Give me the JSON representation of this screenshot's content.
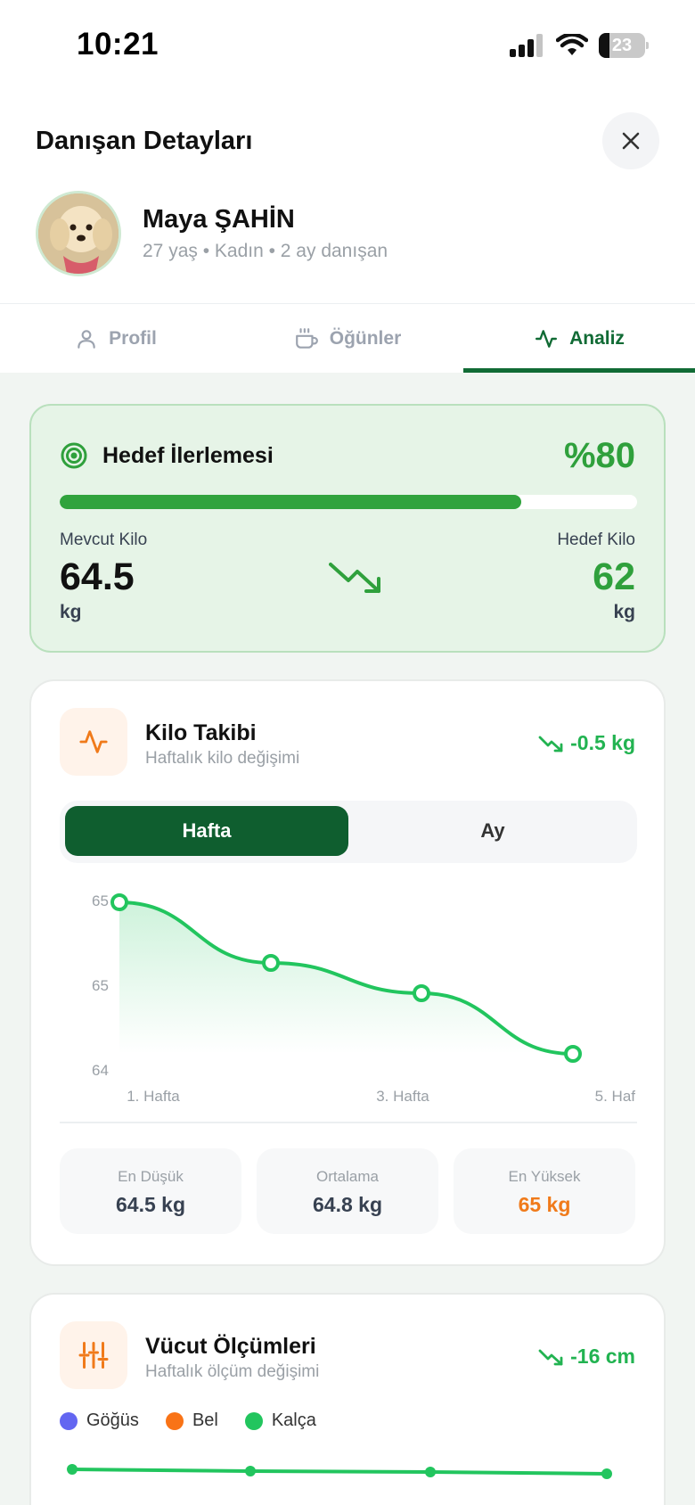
{
  "status_bar": {
    "time": "10:21",
    "battery": "23",
    "battery_level": 0.23
  },
  "header": {
    "title": "Danışan Detayları",
    "client_name": "Maya ŞAHİN",
    "client_meta": "27 yaş • Kadın • 2 ay danışan"
  },
  "tabs": [
    {
      "label": "Profil",
      "icon": "user-icon",
      "active": false
    },
    {
      "label": "Öğünler",
      "icon": "coffee-cup-icon",
      "active": false
    },
    {
      "label": "Analiz",
      "icon": "activity-icon",
      "active": true
    }
  ],
  "goal": {
    "title": "Hedef İlerlemesi",
    "percent_label": "%80",
    "progress": 0.8,
    "current_label": "Mevcut Kilo",
    "current_value": "64.5",
    "current_unit": "kg",
    "target_label": "Hedef Kilo",
    "target_value": "62",
    "target_unit": "kg",
    "accent_color": "#2fa03c"
  },
  "weight": {
    "title": "Kilo Takibi",
    "subtitle": "Haftalık kilo değişimi",
    "change": "-0.5 kg",
    "segments": [
      "Hafta",
      "Ay"
    ],
    "stats": [
      {
        "label": "En Düşük",
        "value": "64.5 kg",
        "color": "#374151"
      },
      {
        "label": "Ortalama",
        "value": "64.8 kg",
        "color": "#374151"
      },
      {
        "label": "En Yüksek",
        "value": "65 kg",
        "color": "#f07a1a"
      }
    ]
  },
  "chart_data": {
    "type": "area",
    "x": [
      "1. Hafta",
      "",
      "3. Hafta",
      "",
      "5. Haf"
    ],
    "x_points": [
      1,
      2,
      3,
      4
    ],
    "series": [
      {
        "values": [
          65.0,
          64.8,
          64.7,
          64.5
        ]
      }
    ],
    "y_tick_labels": [
      "65",
      "65",
      "64"
    ],
    "ylim": [
      64.5,
      65.0
    ],
    "line_color": "#22c55e",
    "grid": false
  },
  "measurements": {
    "title": "Vücut Ölçümleri",
    "subtitle": "Haftalık ölçüm değişimi",
    "change": "-16 cm",
    "legend": [
      {
        "label": "Göğüs",
        "color": "#6366f1"
      },
      {
        "label": "Bel",
        "color": "#f97316"
      },
      {
        "label": "Kalça",
        "color": "#22c55e"
      }
    ]
  }
}
